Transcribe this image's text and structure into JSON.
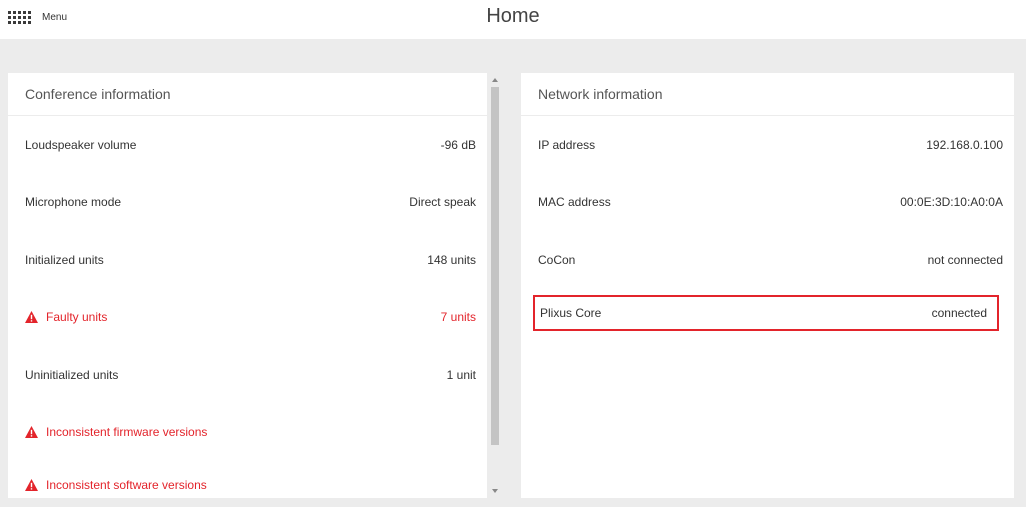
{
  "header": {
    "menu_label": "Menu",
    "title": "Home"
  },
  "conference": {
    "title": "Conference information",
    "rows": [
      {
        "label": "Loudspeaker volume",
        "value": "-96 dB"
      },
      {
        "label": "Microphone mode",
        "value": "Direct speak"
      },
      {
        "label": "Initialized units",
        "value": "148 units"
      },
      {
        "label": "Faulty units",
        "value": "7 units"
      },
      {
        "label": "Uninitialized units",
        "value": "1 unit"
      },
      {
        "label": "Inconsistent firmware versions",
        "value": ""
      },
      {
        "label": "Inconsistent software versions",
        "value": ""
      }
    ]
  },
  "network": {
    "title": "Network information",
    "rows": [
      {
        "label": "IP address",
        "value": "192.168.0.100"
      },
      {
        "label": "MAC address",
        "value": "00:0E:3D:10:A0:0A"
      },
      {
        "label": "CoCon",
        "value": "not connected"
      },
      {
        "label": "Plixus Core",
        "value": "connected"
      }
    ]
  },
  "icons": {
    "menu": "grid-icon",
    "warning": "warning-icon"
  },
  "colors": {
    "error": "#e3242b",
    "highlight_border": "#e3242b"
  }
}
